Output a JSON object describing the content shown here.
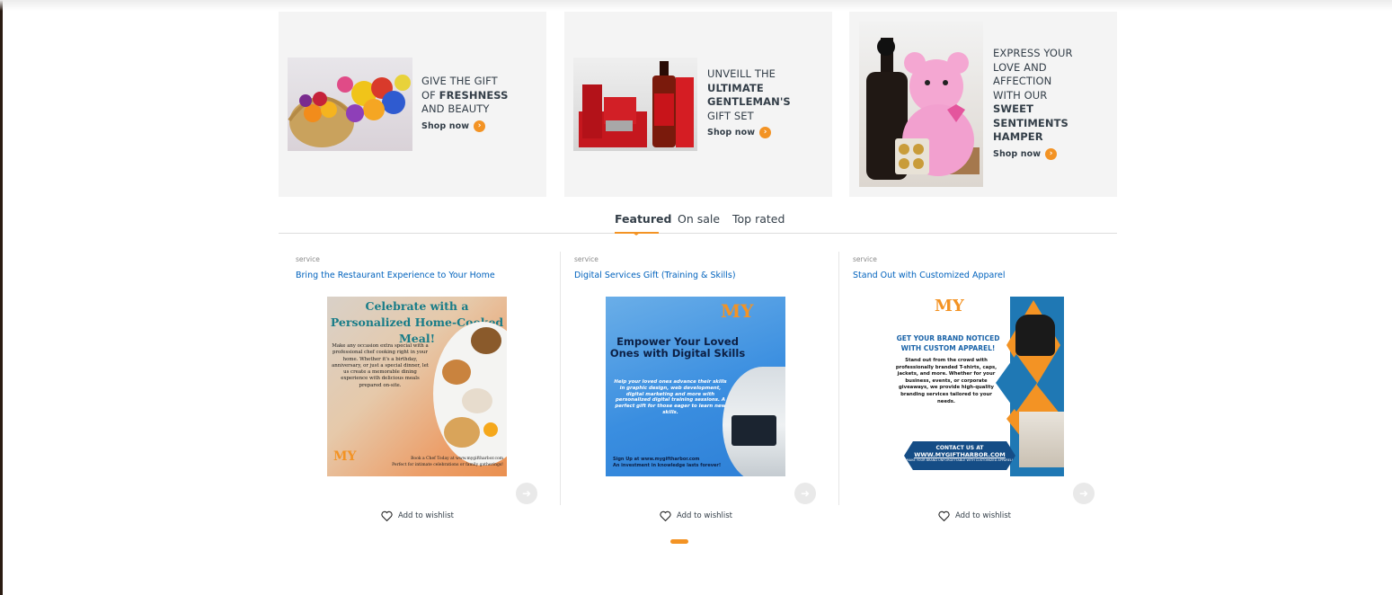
{
  "banners": [
    {
      "line1": "GIVE THE GIFT",
      "line2_prefix": "OF ",
      "line2_bold": "FRESHNESS",
      "line3": "AND BEAUTY",
      "shop_label": "Shop now",
      "image_alt": "fruit-and-flower-basket"
    },
    {
      "line1": "UNVEILL THE",
      "line2_bold": "ULTIMATE",
      "line3_bold": "GENTLEMAN'S",
      "line4": "GIFT SET",
      "shop_label": "Shop now",
      "image_alt": "gentleman-gift-set"
    },
    {
      "line1": "EXPRESS YOUR",
      "line2": "LOVE AND",
      "line3": "AFFECTION",
      "line4": "WITH OUR",
      "line5_bold": "SWEET",
      "line6_bold": "SENTIMENTS",
      "line7_bold": "HAMPER",
      "shop_label": "Shop now",
      "image_alt": "teddy-bear-hamper"
    }
  ],
  "tabs": [
    "Featured",
    "On sale",
    "Top rated"
  ],
  "active_tab": "Featured",
  "products": [
    {
      "category": "service",
      "title": "Bring the Restaurant Experience to Your Home",
      "wishlist_label": "Add to wishlist",
      "thumb": {
        "heading": "Celebrate with a Personalized Home-Cooked Meal!",
        "body": "Make any occasion extra special with a professional chef cooking right in your home. Whether it's a birthday, anniversary, or just a special dinner, let us create a memorable dining experience with delicious meals prepared on-site.",
        "footer1": "Book a Chef Today at www.mygiftharbor.com",
        "footer2": "Perfect for intimate celebrations or family gatherings!",
        "logo": "MY"
      }
    },
    {
      "category": "service",
      "title": "Digital Services Gift (Training & Skills)",
      "wishlist_label": "Add to wishlist",
      "thumb": {
        "logo": "MY",
        "heading": "Empower Your Loved Ones with Digital Skills",
        "body": "Help your loved ones advance their skills in graphic design, web development, digital marketing and more with personalized digital training sessions. A perfect gift for those eager to learn new skills.",
        "footer1": "Sign Up at www.mygiftharbor.com",
        "footer2": "An investment in knowledge lasts forever!"
      }
    },
    {
      "category": "service",
      "title": "Stand Out with Customized Apparel",
      "wishlist_label": "Add to wishlist",
      "thumb": {
        "logo": "MY",
        "heading": "GET YOUR BRAND NOTICED WITH CUSTOM APPAREL!",
        "body": "Stand out from the crowd with professionally branded T-shirts, caps, jackets, and more. Whether for your business, events, or corporate giveaways, we provide high-quality branding services tailored to your needs.",
        "contact1": "CONTACT US AT",
        "contact2": "WWW.MYGIFTHARBOR.COM",
        "contact3": "MAKE YOUR BRAND UNFORGETTABLE WITH CUSTOMIZED APPAREL!"
      }
    }
  ],
  "colors": {
    "accent": "#f39324",
    "link": "#0062bd",
    "banner_bg": "#f4f4f4"
  }
}
